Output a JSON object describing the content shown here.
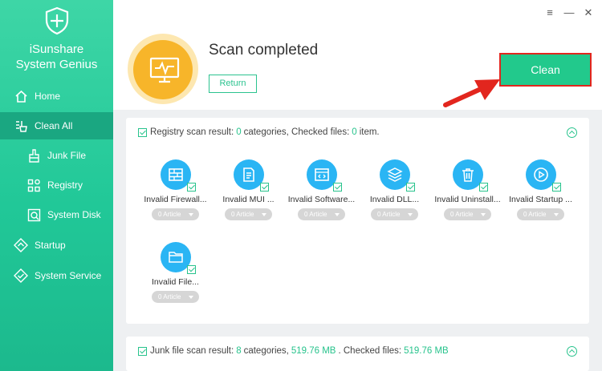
{
  "app": {
    "brand_line1": "iSunshare",
    "brand_line2": "System Genius"
  },
  "colors": {
    "accent": "#27c38c",
    "icon_blue": "#2ab5f4",
    "badge_orange": "#f7b52a",
    "highlight_red": "#e2261e"
  },
  "nav": {
    "home": "Home",
    "clean_all": "Clean All",
    "junk_file": "Junk File",
    "registry": "Registry",
    "system_disk": "System Disk",
    "startup": "Startup",
    "system_service": "System Service"
  },
  "window": {
    "menu_icon": "≡",
    "minimize_icon": "—",
    "close_icon": "✕"
  },
  "header": {
    "title": "Scan completed",
    "return_label": "Return",
    "clean_label": "Clean"
  },
  "registry_panel": {
    "prefix": "Registry scan result:",
    "categories_count": "0",
    "categories_text": "categories, Checked files:",
    "files_count": "0",
    "files_text": "item.",
    "items": [
      {
        "label": "Invalid Firewall...",
        "count": "0 Article",
        "icon": "firewall-icon"
      },
      {
        "label": "Invalid MUI ...",
        "count": "0 Article",
        "icon": "document-edit-icon"
      },
      {
        "label": "Invalid Software...",
        "count": "0 Article",
        "icon": "code-window-icon"
      },
      {
        "label": "Invalid DLL...",
        "count": "0 Article",
        "icon": "layers-icon"
      },
      {
        "label": "Invalid Uninstall...",
        "count": "0 Article",
        "icon": "trash-icon"
      },
      {
        "label": "Invalid Startup ...",
        "count": "0 Article",
        "icon": "play-icon"
      },
      {
        "label": "Invalid File...",
        "count": "0 Article",
        "icon": "folder-icon"
      }
    ]
  },
  "junk_panel": {
    "prefix": "Junk file scan result:",
    "categories_count": "8",
    "categories_text": "categories,",
    "size1": "519.76 MB",
    "files_text": ". Checked files:",
    "size2": "519.76 MB"
  }
}
